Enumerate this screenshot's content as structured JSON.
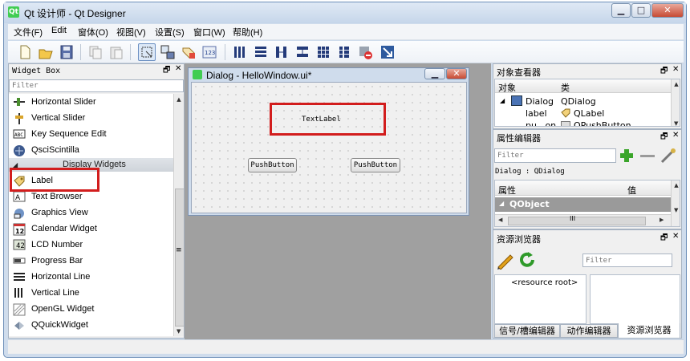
{
  "window": {
    "title": "Qt 设计师 - Qt Designer",
    "app_icon_label": "Qt",
    "buttons": {
      "minimize": "▁",
      "maximize": "□",
      "close": "✕"
    }
  },
  "menubar": {
    "items": [
      "文件(F)",
      "Edit",
      "窗体(O)",
      "视图(V)",
      "设置(S)",
      "窗口(W)",
      "帮助(H)"
    ]
  },
  "toolbar": {
    "icons": [
      "new-icon",
      "open-icon",
      "save-icon",
      "copy-icon",
      "paste-icon",
      "edit-widgets-icon",
      "edit-signals-icon",
      "edit-buddies-icon",
      "edit-tab-order-icon",
      "layout-horizontal-icon",
      "layout-vertical-icon",
      "layout-horizontal-splitter-icon",
      "layout-vertical-splitter-icon",
      "layout-grid-icon",
      "layout-form-icon",
      "break-layout-icon",
      "adjust-size-icon"
    ]
  },
  "widget_box": {
    "title": "Widget Box",
    "filter_placeholder": "Filter",
    "items": [
      {
        "label": "Horizontal Slider",
        "icon": "horizontal-slider-icon"
      },
      {
        "label": "Vertical Slider",
        "icon": "vertical-slider-icon"
      },
      {
        "label": "Key Sequence Edit",
        "icon": "key-sequence-icon"
      },
      {
        "label": "QsciScintilla",
        "icon": "qscintilla-icon"
      }
    ],
    "category": "Display Widgets",
    "display_items": [
      {
        "label": "Label",
        "icon": "label-icon"
      },
      {
        "label": "Text Browser",
        "icon": "text-browser-icon"
      },
      {
        "label": "Graphics View",
        "icon": "graphics-view-icon"
      },
      {
        "label": "Calendar Widget",
        "icon": "calendar-icon"
      },
      {
        "label": "LCD Number",
        "icon": "lcd-number-icon"
      },
      {
        "label": "Progress Bar",
        "icon": "progress-bar-icon"
      },
      {
        "label": "Horizontal Line",
        "icon": "horizontal-line-icon"
      },
      {
        "label": "Vertical Line",
        "icon": "vertical-line-icon"
      },
      {
        "label": "OpenGL Widget",
        "icon": "opengl-icon"
      },
      {
        "label": "QQuickWidget",
        "icon": "qquickwidget-icon"
      }
    ]
  },
  "form_window": {
    "title": "Dialog - HelloWindow.ui*",
    "text_label": "TextLabel",
    "button1": "PushButton",
    "button2": "PushButton"
  },
  "object_inspector": {
    "title": "对象查看器",
    "col_object": "对象",
    "col_class": "类",
    "rows": [
      {
        "object": "Dialog",
        "class": "QDialog"
      },
      {
        "object": "label",
        "class": "QLabel"
      },
      {
        "object": "pu...on",
        "class": "QPushButton"
      }
    ]
  },
  "property_editor": {
    "title": "属性编辑器",
    "filter_placeholder": "Filter",
    "context": "Dialog : QDialog",
    "col_property": "属性",
    "col_value": "值",
    "group": "QObject",
    "scroll_mark": "III"
  },
  "resource_browser": {
    "title": "资源浏览器",
    "filter_placeholder": "Filter",
    "root": "<resource root>",
    "tabs": [
      "信号/槽编辑器",
      "动作编辑器",
      "资源浏览器"
    ]
  },
  "scrollbar_marker": "≡",
  "dock_buttons": {
    "float": "🗗",
    "close": "✕"
  },
  "colors": {
    "highlight_red": "#d21d1d",
    "qobject_row": "#9a9a9a",
    "window_frame": "#cfdcec"
  }
}
